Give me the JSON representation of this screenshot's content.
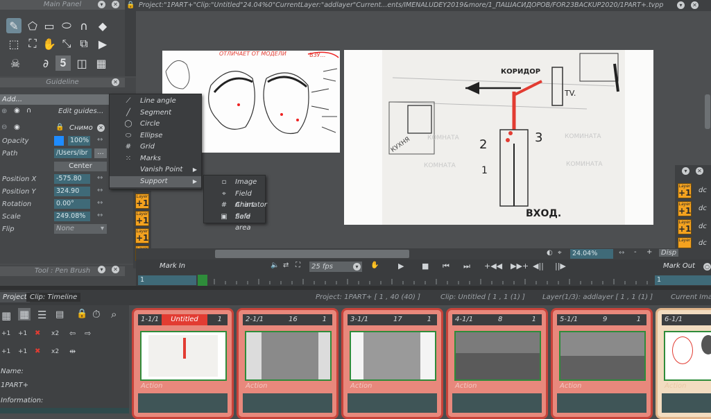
{
  "main_panel": {
    "title": "Main Panel"
  },
  "guideline": {
    "title": "Guideline",
    "add_label": "Add...",
    "edit_guides": "Edit guides...",
    "layer_name": "Снимо",
    "props": [
      {
        "label": "Opacity",
        "value": "100%"
      },
      {
        "label": "Path",
        "value": "/Users/ibr"
      },
      {
        "label": "",
        "value": "Center"
      },
      {
        "label": "Position X",
        "value": "-575.80"
      },
      {
        "label": "Position Y",
        "value": "324.90"
      },
      {
        "label": "Rotation",
        "value": "0.00°"
      },
      {
        "label": "Scale",
        "value": "249.08%"
      },
      {
        "label": "Flip",
        "value": "None"
      }
    ],
    "path_more": "..."
  },
  "tool_panel": {
    "title": "Tool : Pen Brush"
  },
  "title_bar": {
    "path": "Project:\"1PART+\"Clip:\"Untitled\"24.04%0\"CurrentLayer:\"addlayer\"Current...ents/IMENALUDEY2019&more/1_ПАШАСИДОРОВ/FOR23BACKUP2020/1PART+.tvpp"
  },
  "add_menu": {
    "items": [
      {
        "icon": "line-angle-icon",
        "glyph": "⟋",
        "label": "Line angle"
      },
      {
        "icon": "segment-icon",
        "glyph": "╱",
        "label": "Segment"
      },
      {
        "icon": "circle-icon",
        "glyph": "◯",
        "label": "Circle"
      },
      {
        "icon": "ellipse-icon",
        "glyph": "⬭",
        "label": "Ellipse"
      },
      {
        "icon": "grid-icon",
        "glyph": "#",
        "label": "Grid"
      },
      {
        "icon": "marks-icon",
        "glyph": "⁙",
        "label": "Marks"
      },
      {
        "icon": "vanish-point-icon",
        "glyph": "",
        "label": "Vanish Point"
      },
      {
        "icon": "support-icon",
        "glyph": "",
        "label": "Support"
      }
    ]
  },
  "support_menu": {
    "items": [
      {
        "icon": "image-icon",
        "glyph": "▫",
        "label": "Image"
      },
      {
        "icon": "field-chart-icon",
        "glyph": "⌖",
        "label": "Field Chart"
      },
      {
        "icon": "animator-field-icon",
        "glyph": "#",
        "label": "Animator field"
      },
      {
        "icon": "safe-area-icon",
        "glyph": "▣",
        "label": "Safe area"
      }
    ]
  },
  "canvas": {
    "sketch_words": {
      "kitchen": "КУХНЯ",
      "room": "КОМНАТА",
      "room2": "КОМИНАТА",
      "exit": "ВХОД.",
      "corridor": "КОРИДОР",
      "tv": "TV.",
      "one": "1",
      "two": "2",
      "three": "3",
      "tag": "ВЗУ...",
      "header": "ОТЛИЧАЕТ ОТ МОДЕЛИ"
    }
  },
  "view_bar": {
    "zoom": "24.04%",
    "display": "Disp"
  },
  "playback": {
    "mark_in": "Mark In",
    "fps": "25 fps",
    "mark_out": "Mark Out",
    "frame_in": "1",
    "frame_out": "1"
  },
  "timeline": {
    "tab_project": "Project",
    "tab_clip": "Clip: Timeline",
    "status_project": "Project: 1PART+ [ 1 , 40  (40) ]",
    "status_clip": "Clip: Untitled [ 1 , 1  (1) ]",
    "status_layer": "Layer(1/3): addlayer [ 1 , 1  (1) ]",
    "status_current": "Current Imag",
    "name_label": "Name:",
    "name_value": "1PART+",
    "info_label": "Information:",
    "buttons": [
      "+1",
      "+1",
      "✖",
      "x2",
      "+1",
      "+1",
      "✖",
      "x2"
    ]
  },
  "clips": [
    {
      "id": "1-1/1",
      "name": "Untitled",
      "count": "1",
      "action": "Action"
    },
    {
      "id": "2-1/1",
      "name": "16",
      "count": "1",
      "action": "Action"
    },
    {
      "id": "3-1/1",
      "name": "17",
      "count": "1",
      "action": "Action"
    },
    {
      "id": "4-1/1",
      "name": "8",
      "count": "1",
      "action": "Action"
    },
    {
      "id": "5-1/1",
      "name": "9",
      "count": "1",
      "action": "Action"
    },
    {
      "id": "6-1/1",
      "name": "",
      "count": "",
      "action": "Action"
    }
  ],
  "right_panel": {
    "labels": [
      "dc",
      "dc",
      "dc",
      "dc"
    ]
  },
  "colors": {
    "accent_orange": "#f4a21f",
    "clip_red": "#e8887c",
    "clip_border": "#c7433a",
    "field_teal": "#3f6a78",
    "selected_clip_label": "#e23c32"
  }
}
